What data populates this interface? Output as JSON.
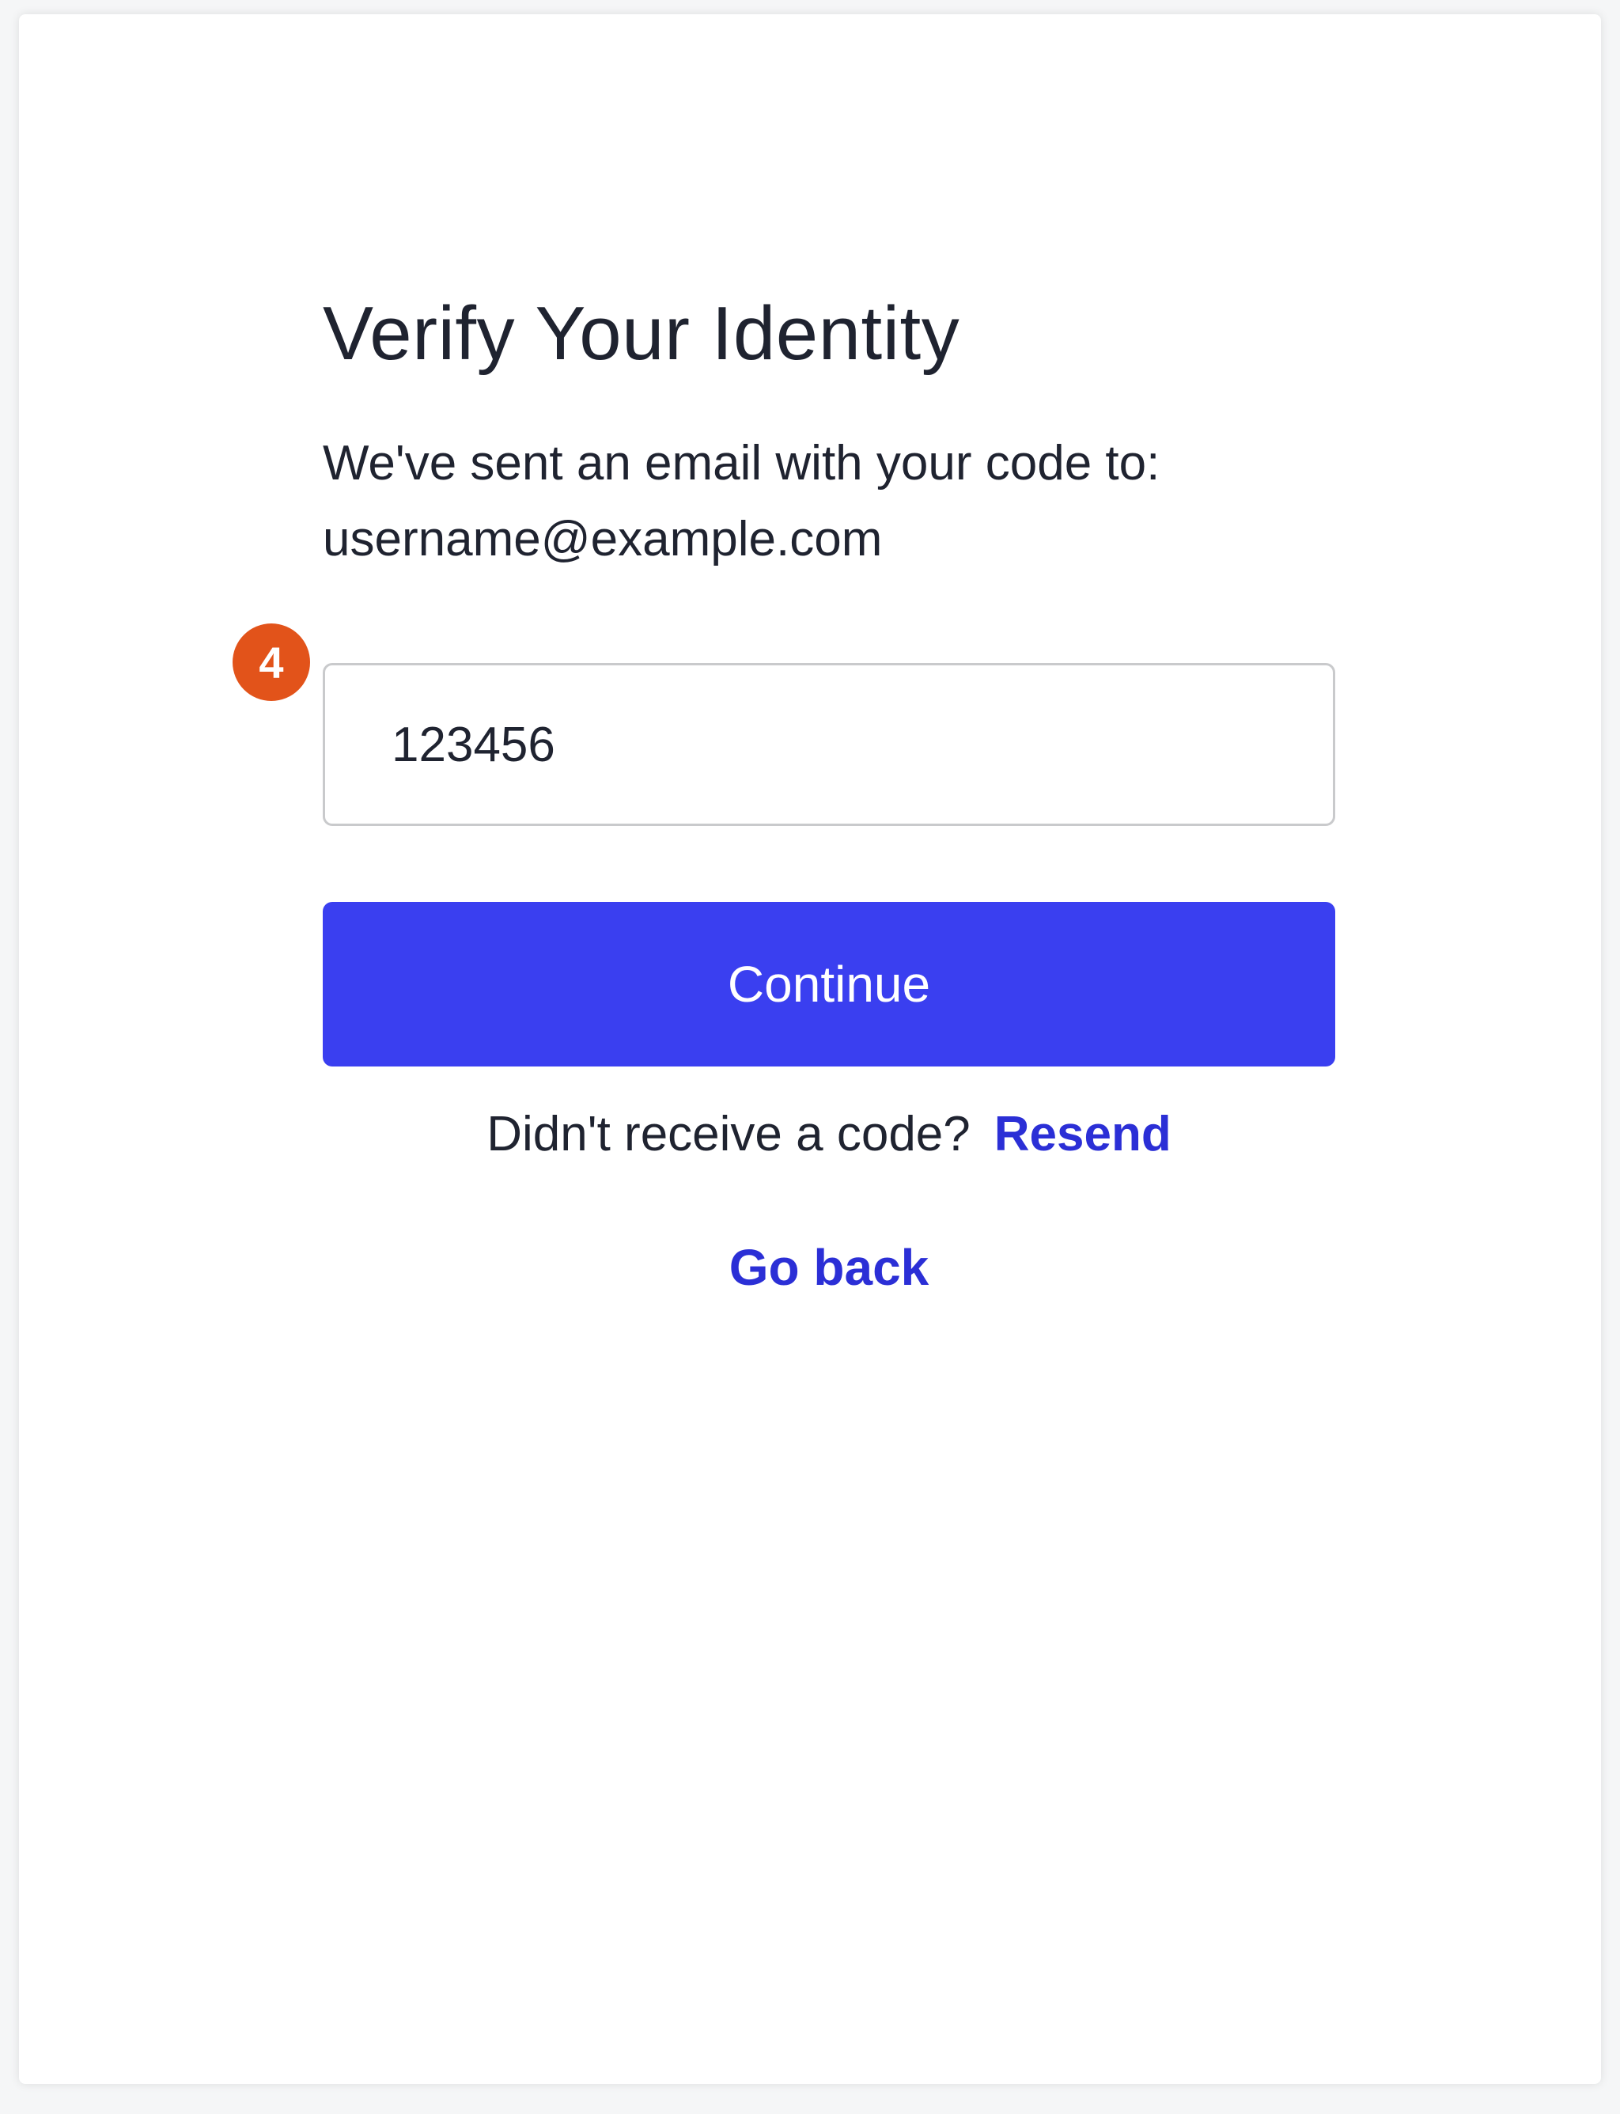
{
  "page": {
    "title": "Verify Your Identity",
    "description_line1": "We've sent an email with your code to:",
    "email": "username@example.com"
  },
  "code_field": {
    "value": "123456",
    "step_badge": "4"
  },
  "actions": {
    "continue_label": "Continue",
    "resend_prompt": "Didn't receive a code?",
    "resend_label": "Resend",
    "go_back_label": "Go back"
  },
  "colors": {
    "primary_button": "#3a3ff0",
    "link": "#2b2fd6",
    "step_badge": "#e2531a",
    "text": "#1f2330",
    "input_border": "#c9cacc"
  }
}
